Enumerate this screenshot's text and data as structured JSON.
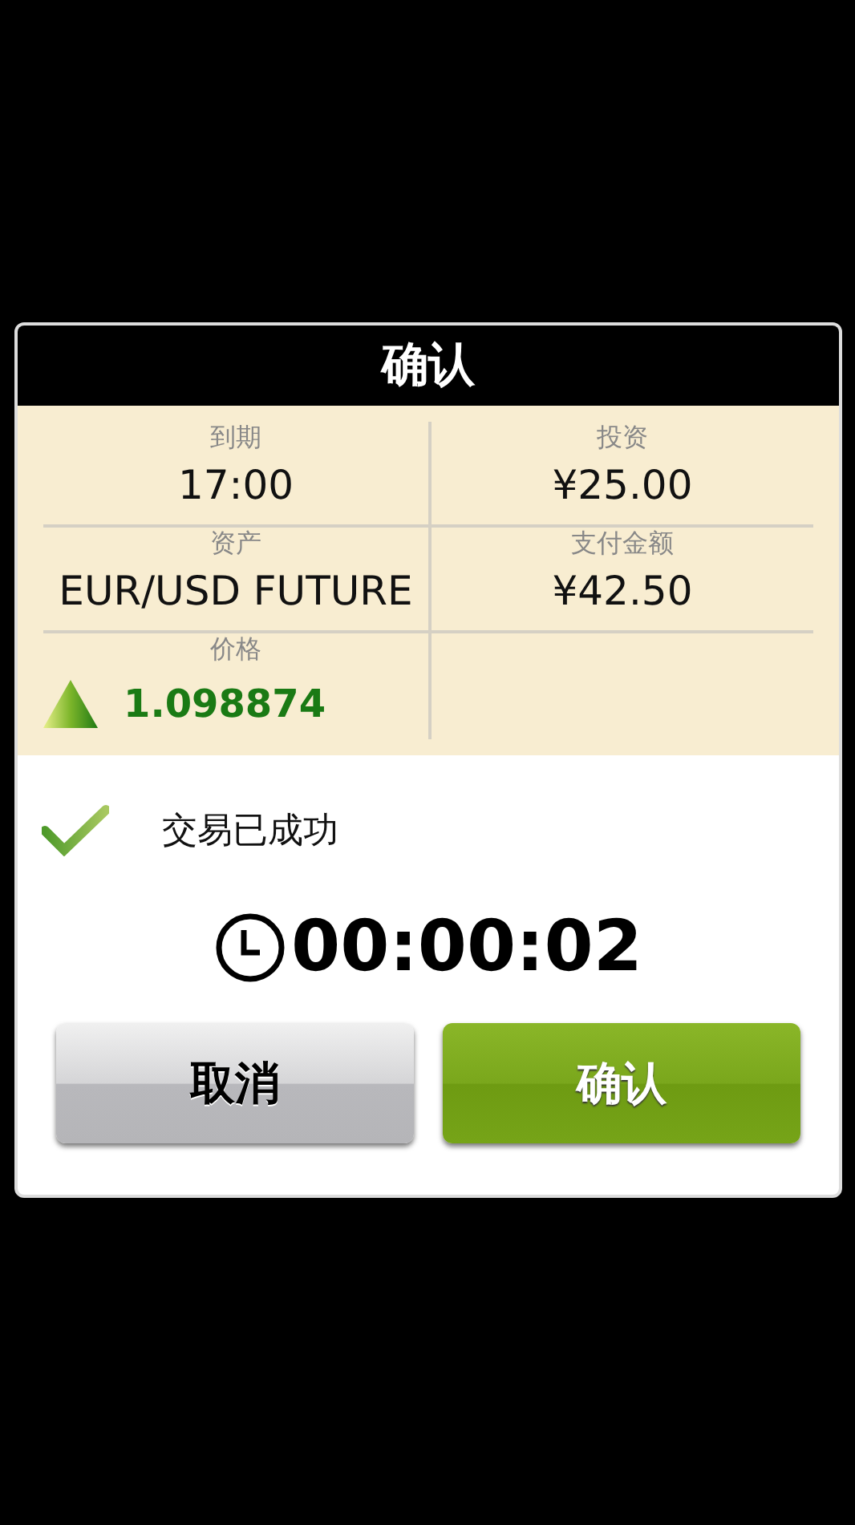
{
  "dialog": {
    "title": "确认",
    "details": [
      {
        "kind": "plain",
        "label": "到期",
        "value": "17:00"
      },
      {
        "kind": "plain",
        "label": "投资",
        "value": "¥25.00"
      },
      {
        "kind": "plain",
        "label": "资产",
        "value": "EUR/USD FUTURE"
      },
      {
        "kind": "plain",
        "label": "支付金额",
        "value": "¥42.50"
      },
      {
        "kind": "rising",
        "label": "价格",
        "value": "1.098874"
      }
    ],
    "status": {
      "kind": "success",
      "message": "交易已成功"
    },
    "timer": "00:00:02",
    "buttons": [
      {
        "label": "取消",
        "kind": "cancel"
      },
      {
        "label": "确认",
        "kind": "confirm"
      }
    ]
  }
}
